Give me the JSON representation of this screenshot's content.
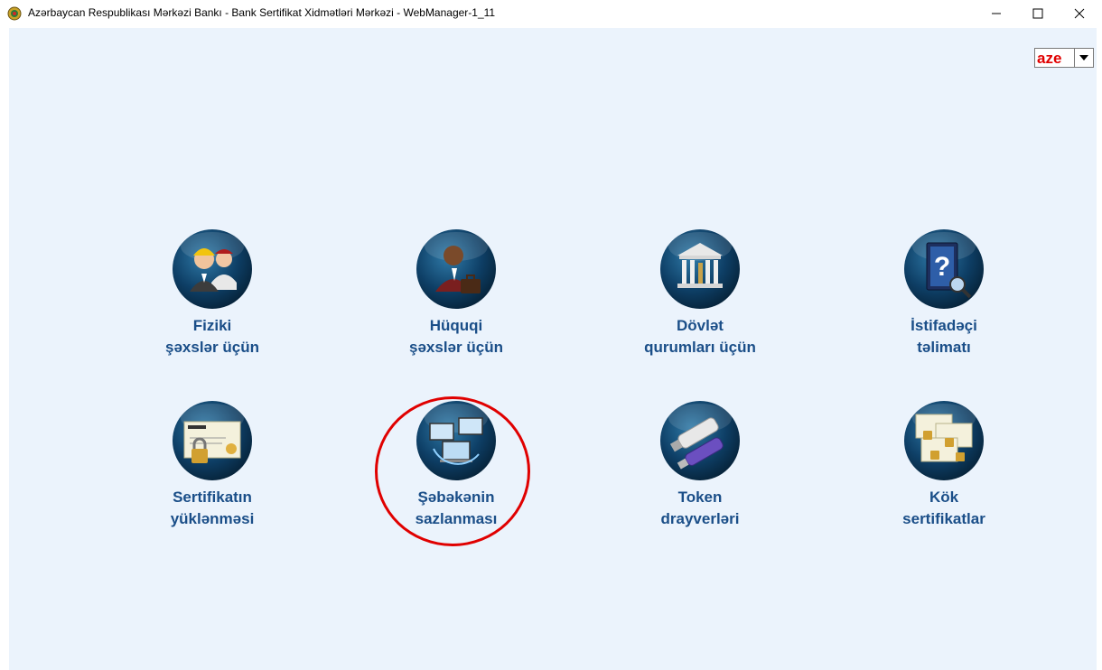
{
  "window": {
    "title": "Azərbaycan Respublikası Mərkəzi Bankı - Bank Sertifikat Xidmətləri Mərkəzi - WebManager-1_11"
  },
  "language_select": {
    "value": "aze"
  },
  "tiles": [
    {
      "line1": "Fiziki",
      "line2": "şəxslər üçün",
      "icon": "people-icon"
    },
    {
      "line1": "Hüquqi",
      "line2": "şəxslər üçün",
      "icon": "businessman-icon"
    },
    {
      "line1": "Dövlət",
      "line2": "qurumları üçün",
      "icon": "government-building-icon"
    },
    {
      "line1": "İstifadəçi",
      "line2": "təlimatı",
      "icon": "help-book-icon"
    },
    {
      "line1": "Sertifikatın",
      "line2": "yüklənməsi",
      "icon": "certificate-lock-icon"
    },
    {
      "line1": "Şəbəkənin",
      "line2": "sazlanması",
      "icon": "network-computers-icon"
    },
    {
      "line1": "Token",
      "line2": "drayverləri",
      "icon": "usb-token-icon"
    },
    {
      "line1": "Kök",
      "line2": "sertifikatlar",
      "icon": "root-certificates-icon"
    }
  ],
  "colors": {
    "background": "#ebf3fc",
    "label": "#1a4e88",
    "circle": "#0e3f66",
    "highlight": "#e00000",
    "language": "#e00000"
  }
}
